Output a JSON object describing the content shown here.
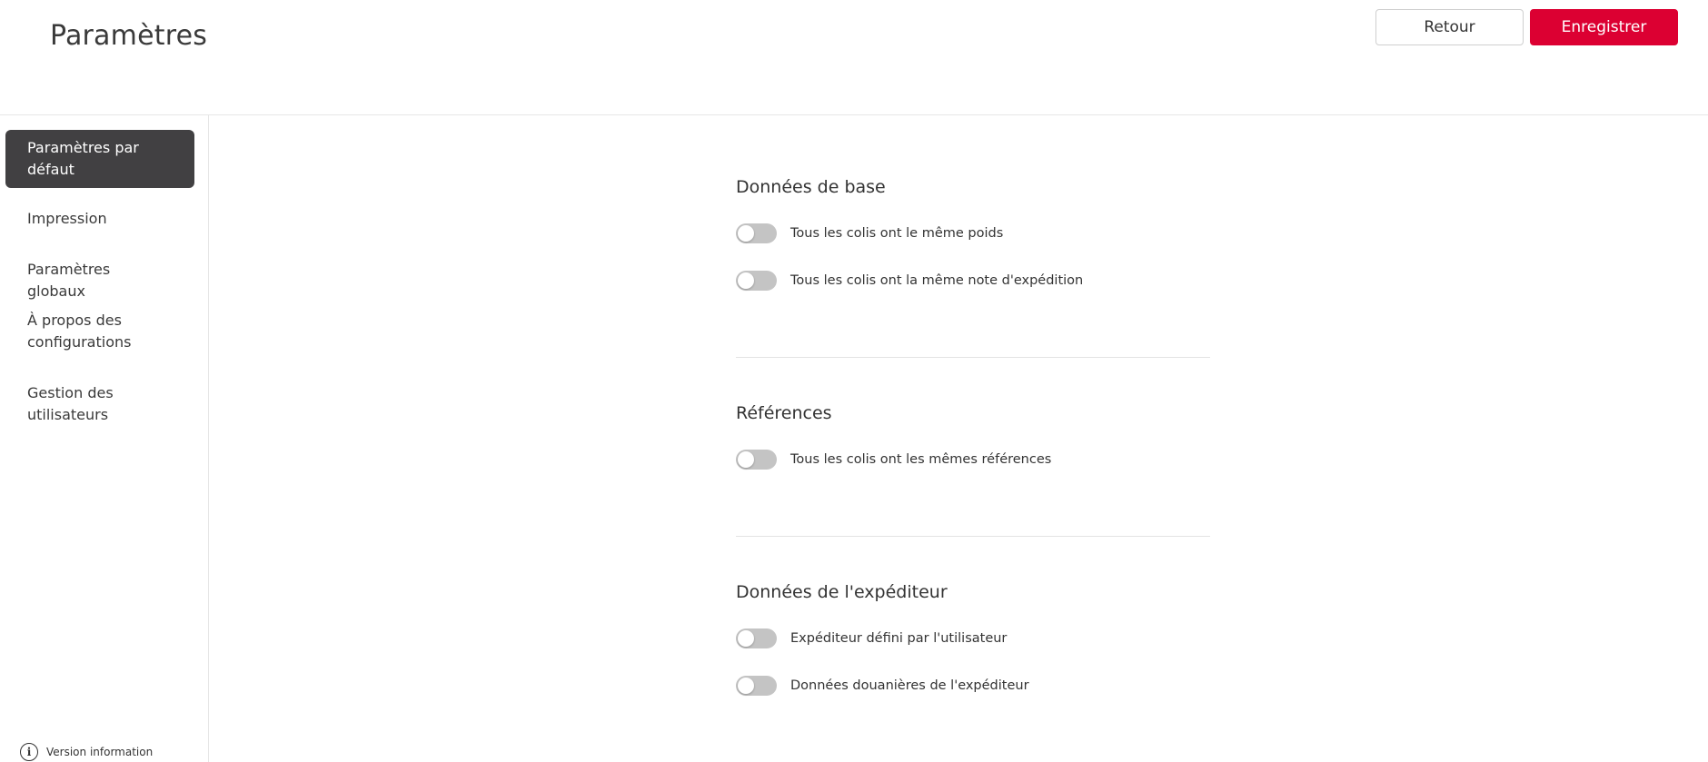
{
  "header": {
    "title": "Paramètres",
    "back_label": "Retour",
    "save_label": "Enregistrer"
  },
  "sidebar": {
    "items": [
      {
        "label": "Paramètres par défaut",
        "active": true
      },
      {
        "label": "Impression",
        "active": false
      },
      {
        "label": "Paramètres globaux",
        "active": false
      },
      {
        "label": "À propos des configurations",
        "active": false
      },
      {
        "label": "Gestion des utilisateurs",
        "active": false
      }
    ],
    "version_label": "Version information"
  },
  "sections": [
    {
      "title": "Données de base",
      "toggles": [
        {
          "label": "Tous les colis ont le même poids",
          "on": false
        },
        {
          "label": "Tous les colis ont la même note d'expédition",
          "on": false
        }
      ]
    },
    {
      "title": "Références",
      "toggles": [
        {
          "label": "Tous les colis ont les mêmes références",
          "on": false
        }
      ]
    },
    {
      "title": "Données de l'expéditeur",
      "toggles": [
        {
          "label": "Expéditeur défini par l'utilisateur",
          "on": false
        },
        {
          "label": "Données douanières de l'expéditeur",
          "on": false
        }
      ]
    }
  ],
  "colors": {
    "accent": "#dc0032",
    "nav_active_bg": "#414042",
    "toggle_off": "#c4c4c4"
  },
  "icons": {
    "info": "info-circle-icon"
  }
}
